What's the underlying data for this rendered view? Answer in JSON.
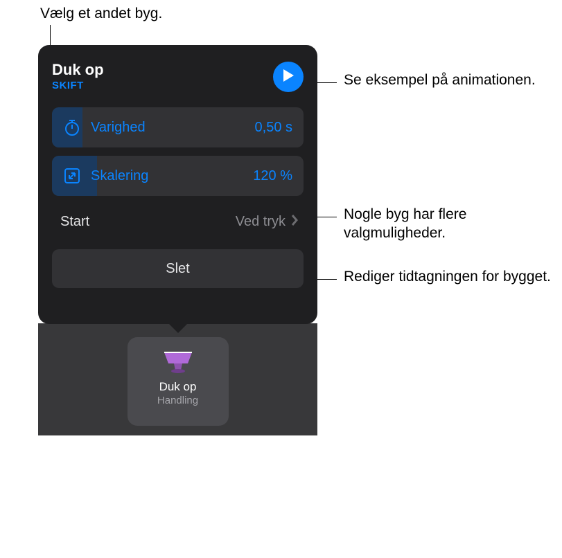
{
  "callouts": {
    "top": "Vælg et andet byg.",
    "play": "Se eksempel på animationen.",
    "scale": "Nogle byg har flere valgmuligheder.",
    "start": "Rediger tidtagningen for bygget."
  },
  "popup": {
    "title": "Duk op",
    "change_label": "SKIFT",
    "duration": {
      "label": "Varighed",
      "value": "0,50 s",
      "fill_pct": 12
    },
    "scale": {
      "label": "Skalering",
      "value": "120 %",
      "fill_pct": 18
    },
    "start_row": {
      "label": "Start",
      "value": "Ved tryk"
    },
    "delete_label": "Slet"
  },
  "build_card": {
    "title": "Duk op",
    "subtitle": "Handling"
  },
  "colors": {
    "accent": "#0a84ff",
    "card_purple": "#b06ad8"
  }
}
